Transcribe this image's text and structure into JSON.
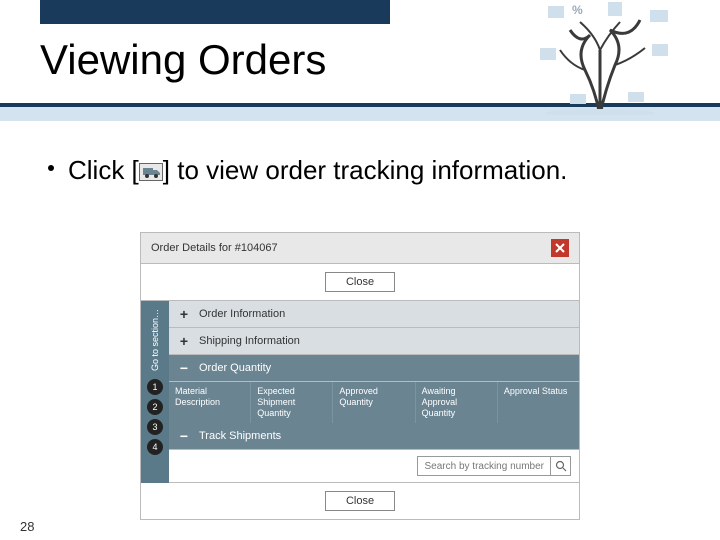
{
  "slide": {
    "title": "Viewing Orders",
    "page_number": "28"
  },
  "bullet": {
    "prefix": "Click [",
    "suffix": "] to view order tracking information."
  },
  "dialog": {
    "title": "Order Details for #104067",
    "close_top": "Close",
    "close_bottom": "Close",
    "sidestrip_label": "Go to section…",
    "steps": [
      "1",
      "2",
      "3",
      "4"
    ],
    "panels": {
      "order_info": "Order Information",
      "shipping_info": "Shipping Information",
      "order_qty": "Order Quantity",
      "track": "Track Shipments"
    },
    "columns": {
      "material": "Material Description",
      "expected": "Expected Shipment Quantity",
      "approved": "Approved Quantity",
      "awaiting": "Awaiting Approval Quantity",
      "status": "Approval Status"
    },
    "search_placeholder": "Search by tracking number"
  }
}
